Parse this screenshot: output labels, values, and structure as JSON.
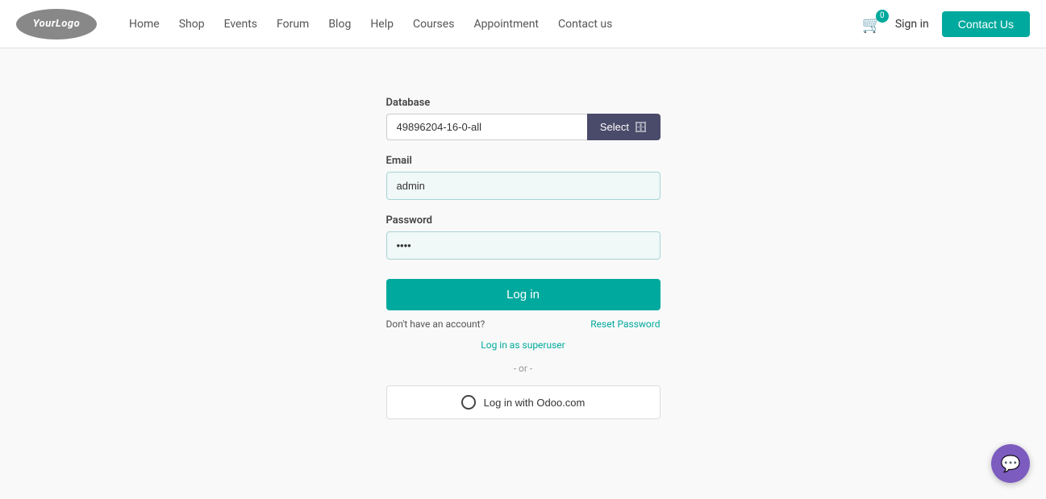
{
  "navbar": {
    "logo_text": "YourLogo",
    "nav_items": [
      {
        "label": "Home",
        "id": "home"
      },
      {
        "label": "Shop",
        "id": "shop"
      },
      {
        "label": "Events",
        "id": "events"
      },
      {
        "label": "Forum",
        "id": "forum"
      },
      {
        "label": "Blog",
        "id": "blog"
      },
      {
        "label": "Help",
        "id": "help"
      },
      {
        "label": "Courses",
        "id": "courses"
      },
      {
        "label": "Appointment",
        "id": "appointment"
      },
      {
        "label": "Contact us",
        "id": "contact-us"
      }
    ],
    "cart_count": "0",
    "sign_in_label": "Sign in",
    "contact_us_label": "Contact Us"
  },
  "form": {
    "database_label": "Database",
    "database_value": "49896204-16-0-all",
    "select_label": "Select",
    "db_icon": "🗄",
    "email_label": "Email",
    "email_value": "admin",
    "email_placeholder": "admin",
    "password_label": "Password",
    "password_value": "••••",
    "login_label": "Log in",
    "no_account_label": "Don't have an account?",
    "reset_password_label": "Reset Password",
    "superuser_label": "Log in as superuser",
    "or_label": "- or -",
    "odoo_login_label": "Log in with Odoo.com"
  },
  "chat": {
    "icon": "💬"
  }
}
